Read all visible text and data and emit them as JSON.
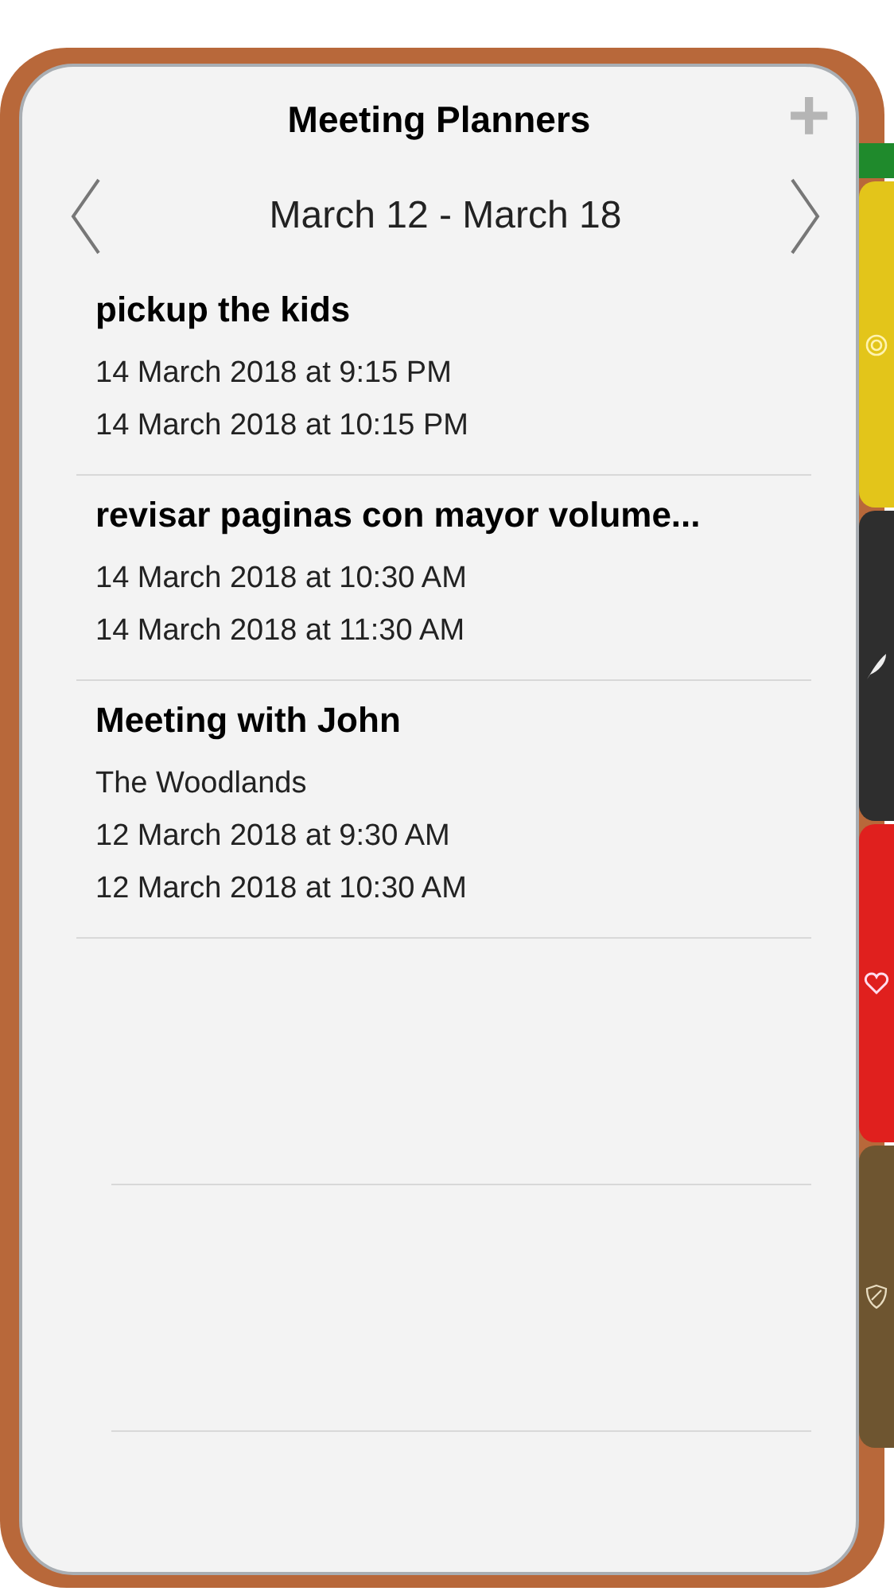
{
  "header": {
    "title": "Meeting Planners",
    "add_button": "+"
  },
  "week": {
    "range": "March 12 - March 18"
  },
  "events": [
    {
      "title": "pickup the kids",
      "start": "14 March 2018 at 9:15 PM",
      "end": "14 March 2018 at 10:15 PM"
    },
    {
      "title": "revisar paginas con mayor volume...",
      "start": "14 March 2018 at 10:30 AM",
      "end": "14 March 2018 at 11:30 AM"
    },
    {
      "title": "Meeting with John",
      "location": "The Woodlands",
      "start": "12 March 2018 at 9:30 AM",
      "end": "12 March 2018 at 10:30 AM"
    }
  ],
  "side_tabs": [
    {
      "kind": "ribbon",
      "color": "#1f8a2c"
    },
    {
      "kind": "target",
      "color": "#e3c51a"
    },
    {
      "kind": "feather",
      "color": "#2e2e2e"
    },
    {
      "kind": "heart",
      "color": "#e0201e"
    },
    {
      "kind": "shield",
      "color": "#6e5530"
    }
  ]
}
